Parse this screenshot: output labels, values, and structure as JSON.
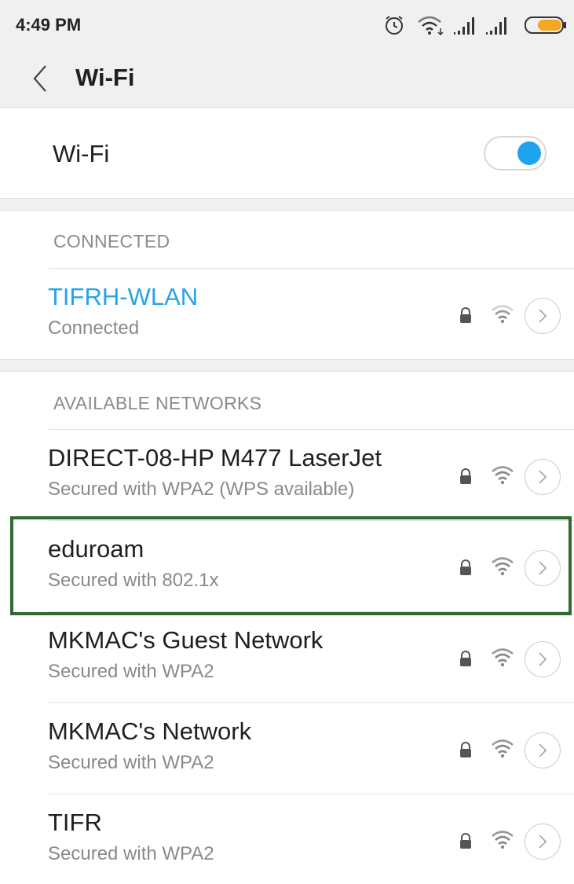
{
  "status_bar": {
    "time": "4:49 PM",
    "icons": [
      "alarm-icon",
      "wifi-status-icon",
      "signal-icon",
      "signal-icon",
      "battery-icon"
    ],
    "battery_color": "#f5a623"
  },
  "header": {
    "title": "Wi-Fi",
    "back_icon": "chevron-left-icon"
  },
  "wifi_toggle": {
    "label": "Wi-Fi",
    "state": "on",
    "accent": "#1ea3ef"
  },
  "connected_section": {
    "header": "CONNECTED",
    "network": {
      "name": "TIFRH-WLAN",
      "status": "Connected",
      "name_color": "#29a3e6"
    }
  },
  "available_section": {
    "header": "AVAILABLE NETWORKS",
    "networks": [
      {
        "name": "DIRECT-08-HP M477 LaserJet",
        "security": "Secured with WPA2 (WPS available)"
      },
      {
        "name": "eduroam",
        "security": "Secured with 802.1x",
        "highlighted": true
      },
      {
        "name": "MKMAC's Guest Network",
        "security": "Secured with WPA2"
      },
      {
        "name": "MKMAC's Network",
        "security": "Secured with WPA2"
      },
      {
        "name": "TIFR",
        "security": "Secured with WPA2"
      }
    ]
  },
  "highlight_color": "#2f6b30"
}
